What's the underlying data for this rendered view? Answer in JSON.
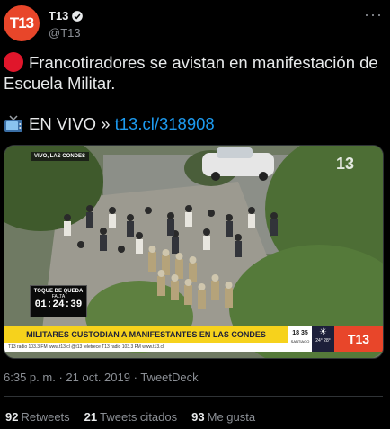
{
  "header": {
    "avatar_text": "T13",
    "display_name": "T13",
    "handle": "@T13",
    "more_label": "···"
  },
  "tweet": {
    "line1": "Francotiradores se avistan en manifestación de Escuela Militar.",
    "line2_prefix": "EN VIVO »",
    "link_text": "t13.cl/318908"
  },
  "media": {
    "overlay_location": "VIVO, LAS CONDES",
    "watermark": "13",
    "curfew_label": "TOQUE DE QUEDA",
    "curfew_sublabel": "FALTA",
    "curfew_timer": "01:24:39",
    "headline": "MILITARES CUSTODIAN A MANIFESTANTES EN LAS CONDES",
    "ticker": "T13 radio 103.3 FM   www.t13.cl   @t13   teletrece   T13 radio 103.3 FM   www.t13.cl",
    "clock": "18 35",
    "city": "SANTIAGO",
    "temps": "24° 28°",
    "logo": "T13",
    "colors": {
      "banner_yellow": "#f6d21c",
      "brand_orange": "#e8462a",
      "dark_navy": "#1d1f3a"
    }
  },
  "meta": {
    "time": "6:35 p. m.",
    "date": "21 oct. 2019",
    "separator": "·",
    "source": "TweetDeck"
  },
  "stats": {
    "retweets_count": "92",
    "retweets_label": "Retweets",
    "quotes_count": "21",
    "quotes_label": "Tweets citados",
    "likes_count": "93",
    "likes_label": "Me gusta"
  }
}
